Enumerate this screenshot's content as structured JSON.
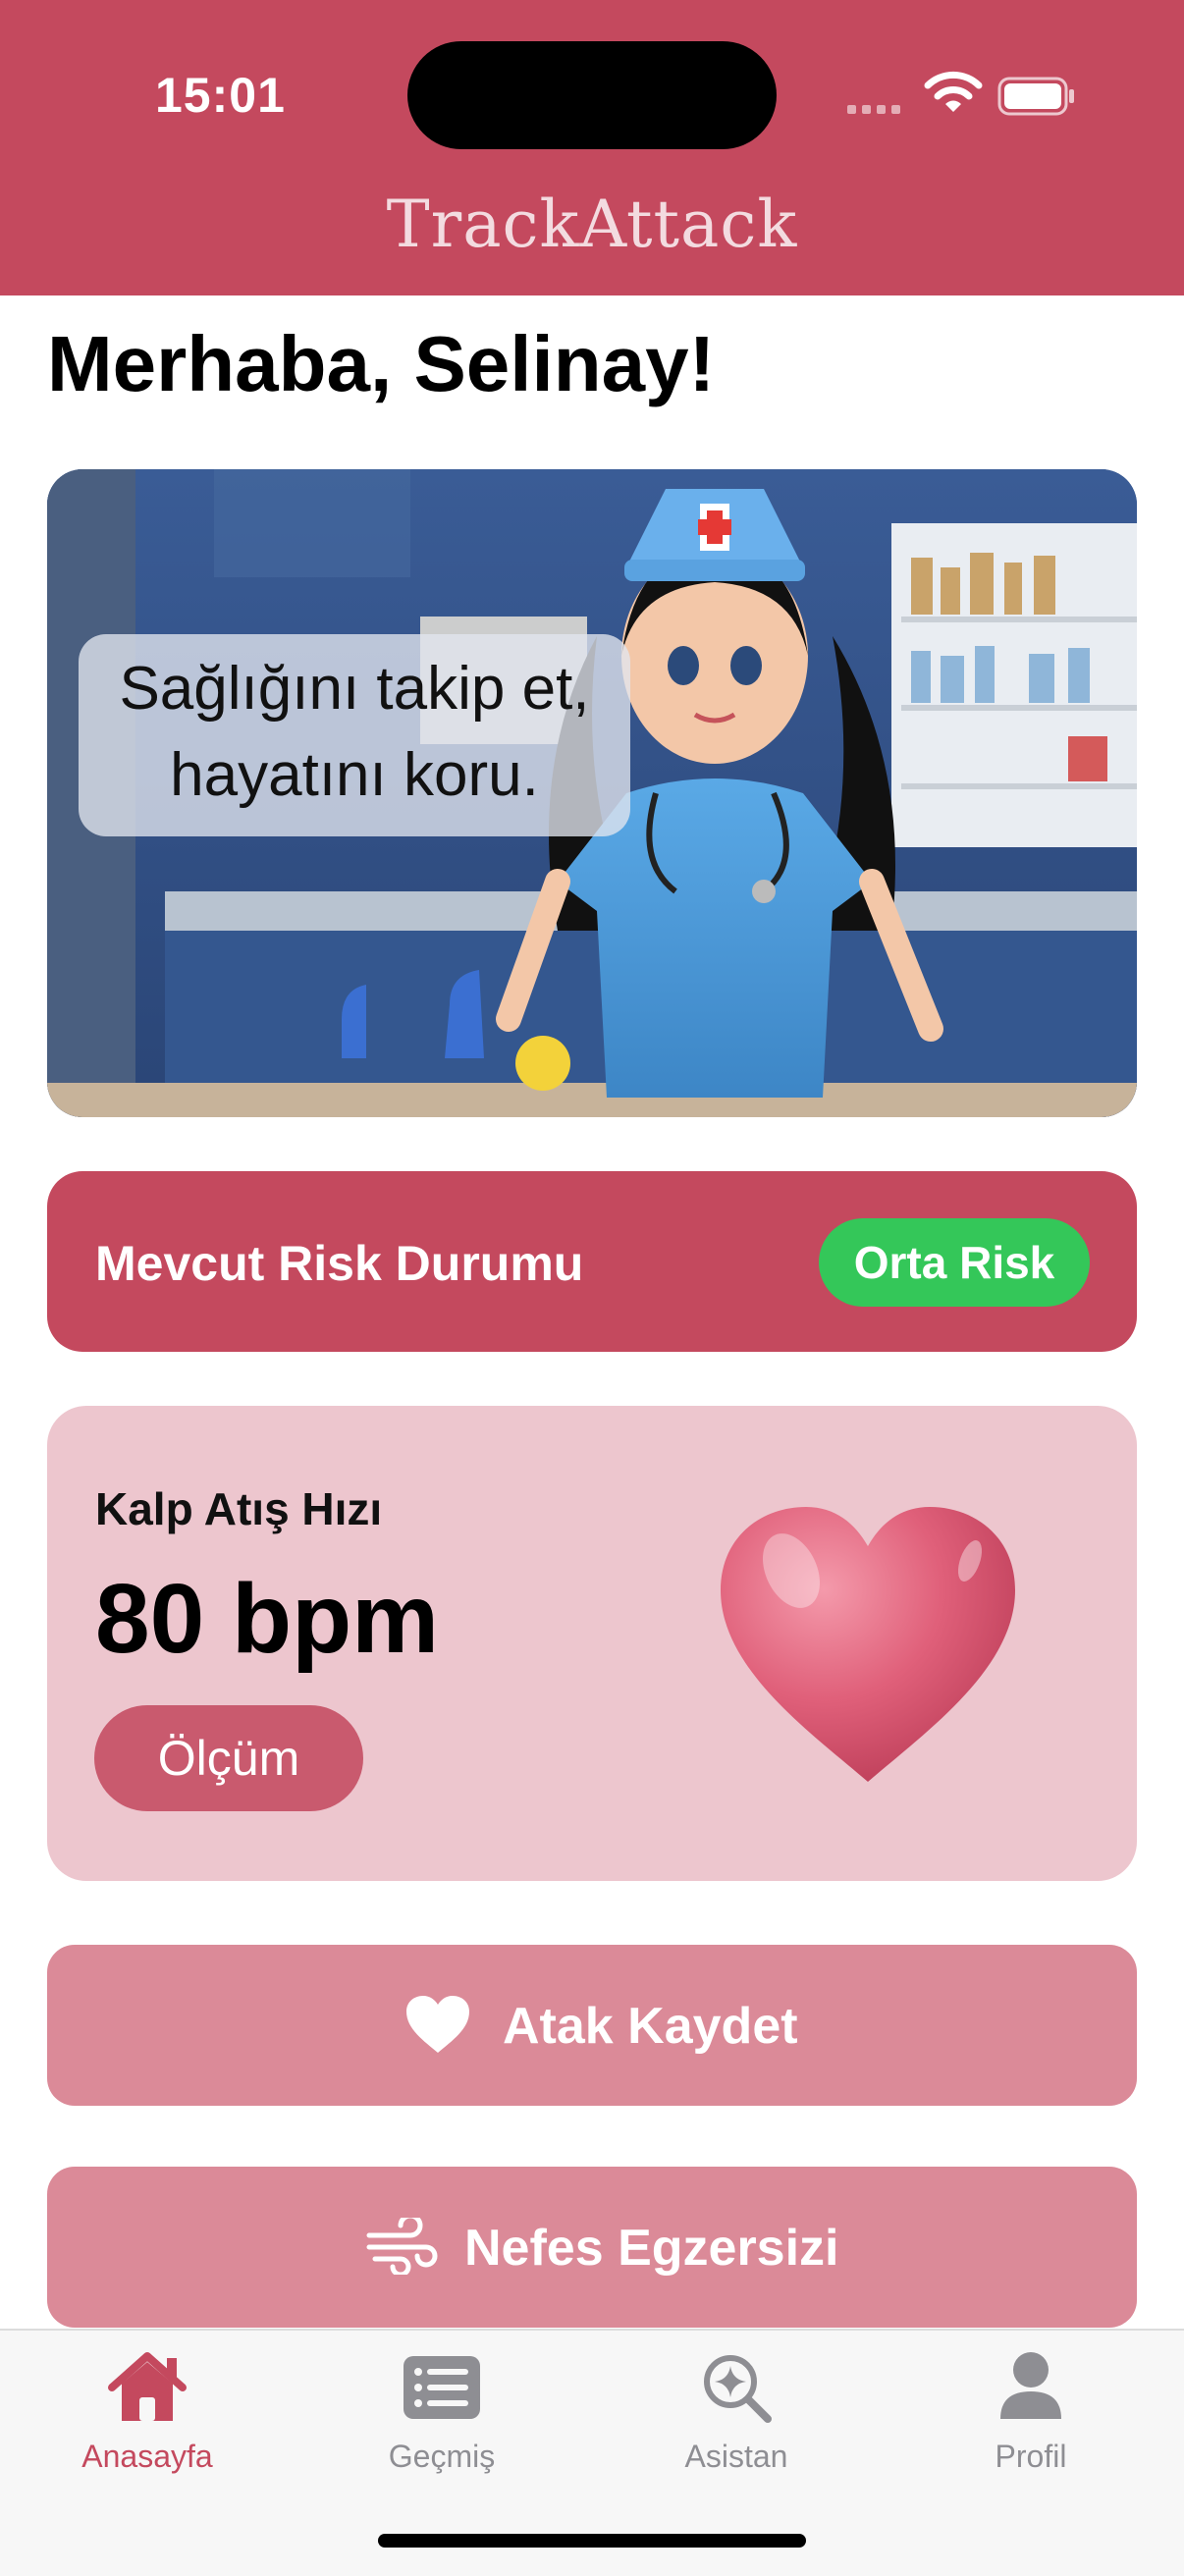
{
  "status_bar": {
    "time": "15:01"
  },
  "app": {
    "title": "TrackAttack"
  },
  "greeting": "Merhaba, Selinay!",
  "hero": {
    "line1": "Sağlığını takip et,",
    "line2": "hayatını koru."
  },
  "risk": {
    "label": "Mevcut Risk Durumu",
    "badge": "Orta Risk",
    "badge_color": "#34c759"
  },
  "heart_rate": {
    "label": "Kalp Atış Hızı",
    "value": "80 bpm",
    "button": "Ölçüm"
  },
  "actions": [
    {
      "label": "Atak Kaydet",
      "icon": "heart-icon"
    },
    {
      "label": "Nefes Egzersizi",
      "icon": "wind-icon"
    }
  ],
  "tabs": [
    {
      "label": "Anasayfa",
      "icon": "house-icon",
      "active": true
    },
    {
      "label": "Geçmiş",
      "icon": "list-icon",
      "active": false
    },
    {
      "label": "Asistan",
      "icon": "sparkle-search-icon",
      "active": false
    },
    {
      "label": "Profil",
      "icon": "person-icon",
      "active": false
    }
  ],
  "colors": {
    "brand": "#c4495e",
    "card_pink": "#edc6ce",
    "action_pink": "#db8a98",
    "tab_active": "#c4495e",
    "tab_inactive": "#8e8e93"
  }
}
